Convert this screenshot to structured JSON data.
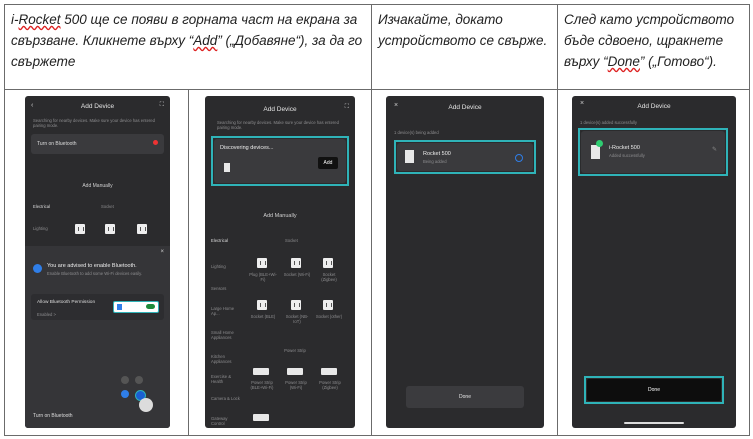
{
  "captions": {
    "col1": [
      "i-",
      "Rocket",
      " 500 ще се появи в горната част на екрана за свързване. Кликнете върху “",
      "Add",
      "” („Добавяне“), за да го свържете"
    ],
    "col2": "Изчакайте, докато устройството се свърже.",
    "col3": [
      "След като устройството бъде сдвоено, щракнете върху “",
      "Done",
      "” („Готово“)."
    ]
  },
  "screen1": {
    "title": "Add Device",
    "search_hint": "Searching for nearby devices. Make sure your device has entered pairing mode.",
    "bluetooth_row": "Turn on Bluetooth",
    "add_manually": "Add Manually",
    "tab_electrical": "Electrical",
    "tab_socket": "Socket",
    "row_lighting": "Lighting",
    "sheet_title": "You are advised to enable Bluetooth.",
    "sheet_sub": "Enable Bluetooth to add some Wi-Fi devices easily.",
    "allow_label": "Allow Bluetooth Permission",
    "allow_state": "Enabled >",
    "turn_on": "Turn on Bluetooth"
  },
  "screen2": {
    "title": "Add Device",
    "search_hint": "Searching for nearby devices. Make sure your device has entered pairing mode.",
    "discovering": "Discovering devices...",
    "add_button": "Add",
    "add_manually": "Add Manually",
    "tab_electrical": "Electrical",
    "tab_socket": "Socket",
    "cats": [
      "Lighting",
      "Sensors",
      "Large Home Ap...",
      "Small Home Appliances",
      "Kitchen Appliances",
      "Exercise & Health",
      "Camera & Lock",
      "Gateway Control"
    ],
    "items_row1": [
      "Plug (BLE+Wi-Fi)",
      "Socket (Wi-Fi)",
      "Socket (Zigbee)"
    ],
    "items_row2": [
      "Socket (BLE)",
      "Socket (NB-IoT)",
      "Socket (other)"
    ],
    "power_strip": "Power Strip",
    "items_row3": [
      "Power Strip (BLE+Wi-Fi)",
      "Power Strip (Wi-Fi)",
      "Power Strip (Zigbee)"
    ]
  },
  "screen3": {
    "title": "Add Device",
    "status": "1 device(s) being added",
    "device_name": "Rocket 500",
    "device_state": "Being added",
    "done": "Done"
  },
  "screen4": {
    "title": "Add Device",
    "status": "1 device(s) added successfully",
    "device_name": "i-Rocket 500",
    "device_state": "Added successfully",
    "done": "Done"
  },
  "colors": {
    "accent": "#2fb3b8",
    "phone_bg": "#2b2b2d",
    "border": "#6b6b6b"
  }
}
